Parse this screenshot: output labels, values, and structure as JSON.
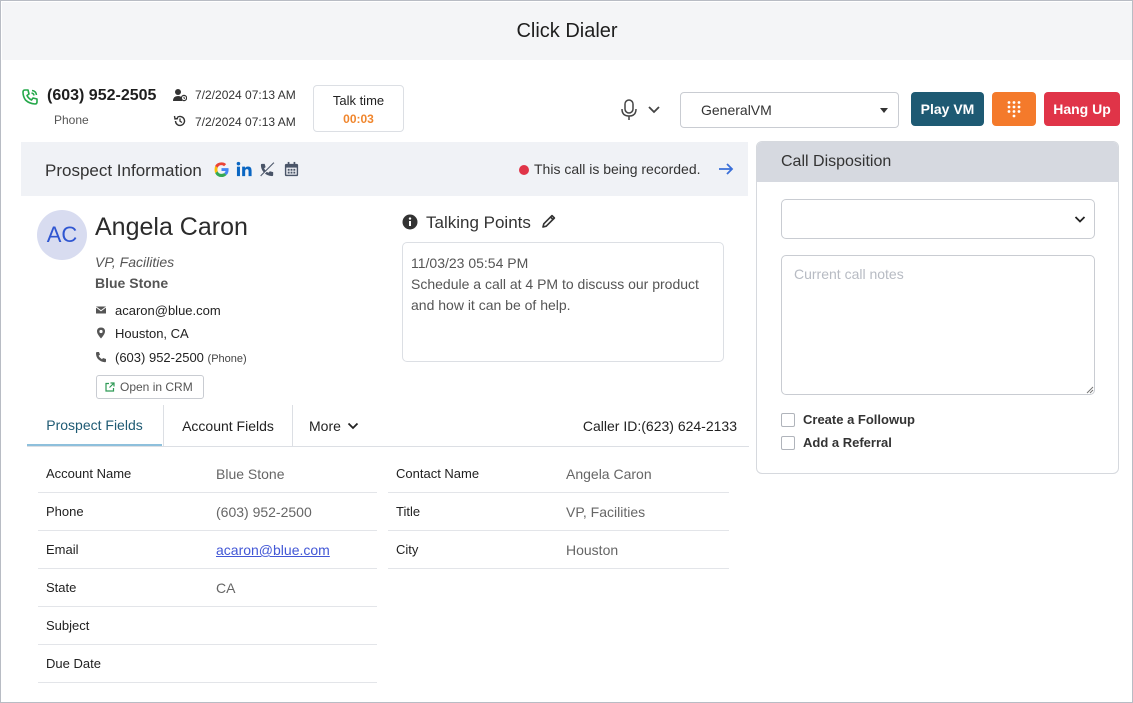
{
  "window": {
    "title": "Click Dialer"
  },
  "call": {
    "number": "(603) 952-2505",
    "type": "Phone",
    "assigned_time": "7/2/2024 07:13 AM",
    "history_time": "7/2/2024 07:13 AM",
    "talk_label": "Talk time",
    "talk_time": "00:03"
  },
  "toolbar": {
    "voicemail_selected": "GeneralVM",
    "play_vm_label": "Play VM",
    "hang_up_label": "Hang Up"
  },
  "prospect": {
    "header_title": "Prospect Information",
    "recording_text": "This call is being recorded.",
    "initials": "AC",
    "name": "Angela Caron",
    "title": "VP, Facilities",
    "company": "Blue Stone",
    "email": "acaron@blue.com",
    "location": "Houston, CA",
    "phone": "(603) 952-2500",
    "phone_type": "(Phone)",
    "open_crm_label": "Open in CRM"
  },
  "talking_points": {
    "title": "Talking Points",
    "date": "11/03/23 05:54 PM",
    "text": "Schedule a call at 4 PM to discuss our product and how it can be of help."
  },
  "tabs": {
    "prospect_fields": "Prospect Fields",
    "account_fields": "Account Fields",
    "more": "More",
    "caller_id": "Caller ID:(623) 624-2133"
  },
  "fields_left": [
    {
      "label": "Account Name",
      "value": "Blue Stone"
    },
    {
      "label": "Phone",
      "value": "(603) 952-2500"
    },
    {
      "label": "Email",
      "value": "acaron@blue.com"
    },
    {
      "label": "State",
      "value": "CA"
    },
    {
      "label": "Subject",
      "value": ""
    },
    {
      "label": "Due Date",
      "value": ""
    }
  ],
  "fields_right": [
    {
      "label": "Contact Name",
      "value": "Angela Caron"
    },
    {
      "label": "Title",
      "value": "VP, Facilities"
    },
    {
      "label": "City",
      "value": "Houston"
    }
  ],
  "disposition": {
    "title": "Call Disposition",
    "selected": "",
    "notes_placeholder": "Current call notes",
    "followup_label": "Create a Followup",
    "referral_label": "Add a Referral"
  },
  "colors": {
    "play_vm": "#1e5a73",
    "dialpad": "#f47a2b",
    "hang_up": "#e03448",
    "talk_time": "#f0862d",
    "recording_dot": "#e03448",
    "link": "#4257d6"
  }
}
